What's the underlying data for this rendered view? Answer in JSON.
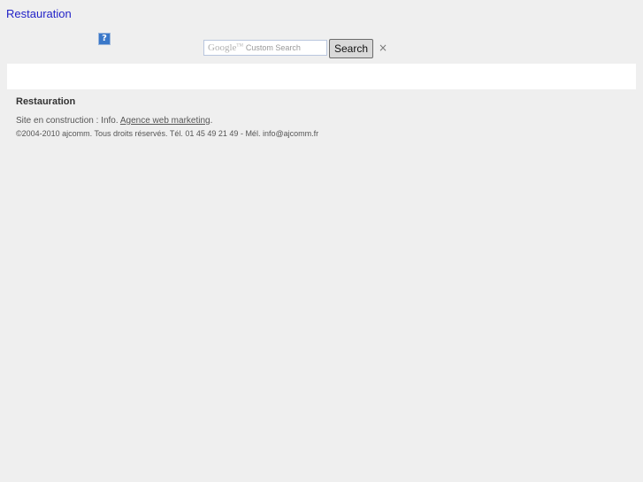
{
  "header": {
    "site_link": "Restauration"
  },
  "search": {
    "brand": "Google",
    "brand_tm": "TM",
    "placeholder": "Custom Search",
    "button_label": "Search",
    "clear_glyph": "×"
  },
  "help": {
    "glyph": "?"
  },
  "footer": {
    "title": "Restauration",
    "line1_prefix": "Site en construction : Info. ",
    "line1_link": "Agence web marketing",
    "line1_suffix": ".",
    "line2": "©2004-2010 ajcomm. Tous droits réservés. Tél. 01 45 49 21 49 - Mél. info@ajcomm.fr"
  },
  "colors": {
    "background": "#efefef",
    "link": "#2323c8",
    "band": "#ffffff"
  }
}
